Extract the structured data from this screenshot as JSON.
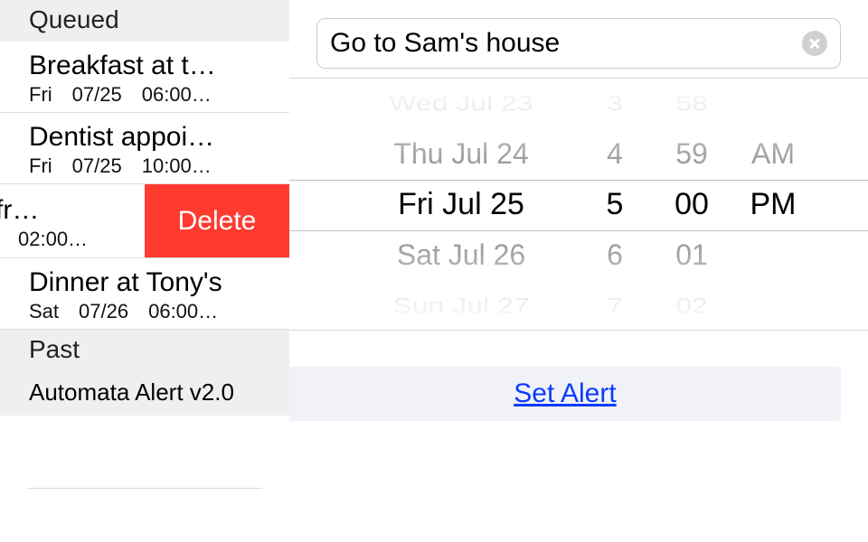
{
  "sidebar": {
    "sections": {
      "queued_label": "Queued",
      "past_label": "Past"
    },
    "items": [
      {
        "title": "Breakfast at t…",
        "day": "Fri",
        "date": "07/25",
        "time": "06:00…"
      },
      {
        "title": "Dentist appoi…",
        "day": "Fri",
        "date": "07/25",
        "time": "10:00…"
      },
      {
        "title": "suit fr…",
        "day": "",
        "date": "",
        "time": "02:00…",
        "swiped": true
      },
      {
        "title": "Dinner at Tony's",
        "day": "Sat",
        "date": "07/26",
        "time": "06:00…"
      }
    ],
    "delete_label": "Delete",
    "footer": "Automata Alert v2.0"
  },
  "editor": {
    "input_value": "Go to Sam's house",
    "picker": {
      "dates": [
        "Wed Jul 23",
        "Thu Jul 24",
        "Fri Jul 25",
        "Sat Jul 26",
        "Sun Jul 27"
      ],
      "hours": [
        "3",
        "4",
        "5",
        "6",
        "7"
      ],
      "minutes": [
        "58",
        "59",
        "00",
        "01",
        "02"
      ],
      "ampm": [
        "AM",
        "PM"
      ]
    },
    "set_alert_label": "Set Alert"
  }
}
